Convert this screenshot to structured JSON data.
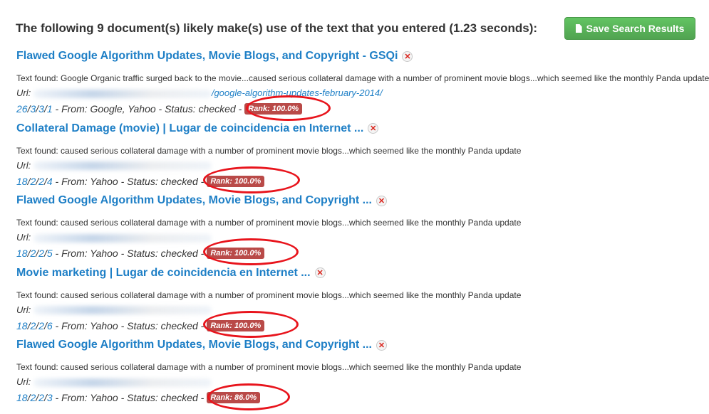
{
  "header": {
    "title": "The following 9 document(s) likely make(s) use of the text that you entered (1.23 seconds):",
    "save_label": "Save Search Results"
  },
  "results": [
    {
      "title": "Flawed Google Algorithm Updates, Movie Blogs, and Copyright - GSQi",
      "found": "Text found: Google Organic traffic surged back to the movie...caused serious collateral damage with a number of prominent movie blogs...which seemed like the monthly Panda update",
      "url_label": "Url:",
      "url_visible": "/google-algorithm-updates-february-2014/",
      "links": [
        "26",
        "3",
        "3",
        "1"
      ],
      "meta": "- From: Google, Yahoo - Status: checked -",
      "rank": "Rank: 100.0%"
    },
    {
      "title": "Collateral Damage (movie) | Lugar de coincidencia en Internet ...",
      "found": "Text found: caused serious collateral damage with a number of prominent movie blogs...which seemed like the monthly Panda update",
      "url_label": "Url:",
      "url_visible": "",
      "links": [
        "18",
        "2",
        "2",
        "4"
      ],
      "meta": "- From: Yahoo - Status: checked -",
      "rank": "Rank: 100.0%"
    },
    {
      "title": "Flawed Google Algorithm Updates, Movie Blogs, and Copyright ...",
      "found": "Text found: caused serious collateral damage with a number of prominent movie blogs...which seemed like the monthly Panda update",
      "url_label": "Url:",
      "url_visible": "",
      "links": [
        "18",
        "2",
        "2",
        "5"
      ],
      "meta": "- From: Yahoo - Status: checked -",
      "rank": "Rank: 100.0%"
    },
    {
      "title": "Movie marketing | Lugar de coincidencia en Internet ...",
      "found": "Text found: caused serious collateral damage with a number of prominent movie blogs...which seemed like the monthly Panda update",
      "url_label": "Url:",
      "url_visible": "",
      "links": [
        "18",
        "2",
        "2",
        "6"
      ],
      "meta": "- From: Yahoo - Status: checked -",
      "rank": "Rank: 100.0%"
    },
    {
      "title": "Flawed Google Algorithm Updates, Movie Blogs, and Copyright ...",
      "found": "Text found: caused serious collateral damage with a number of prominent movie blogs...which seemed like the monthly Panda update",
      "url_label": "Url:",
      "url_visible": "",
      "links": [
        "18",
        "2",
        "2",
        "3"
      ],
      "meta": "- From: Yahoo - Status: checked -",
      "rank": "Rank: 86.0%"
    }
  ],
  "icons": {
    "remove": "close-icon",
    "save": "document-icon"
  },
  "colors": {
    "link": "#1e7fc6",
    "rank_badge": "#b94a48",
    "annotation_ring": "#e8141c",
    "save_button": "#5bb75b"
  }
}
